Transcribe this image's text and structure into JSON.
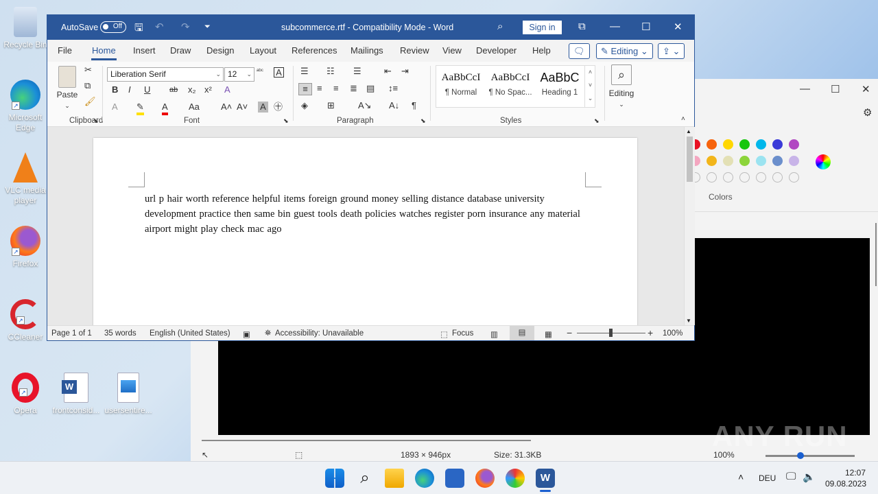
{
  "desktop": {
    "icons": [
      {
        "label": "Recycle Bin"
      },
      {
        "label": "Microsoft Edge"
      },
      {
        "label": "VLC media player"
      },
      {
        "label": "Firefox"
      },
      {
        "label": "CCleaner"
      },
      {
        "label": "Opera"
      },
      {
        "label": "frontconsid..."
      },
      {
        "label": "usersentire..."
      }
    ]
  },
  "paint": {
    "colors_label": "Colors",
    "status": {
      "dimensions": "1893 × 946px",
      "size": "Size: 31.3KB",
      "zoom": "100%"
    },
    "swatches_row1": [
      "#e81123",
      "#f7630c",
      "#ffd700",
      "#16c60c",
      "#00b7eb",
      "#3a3ad8",
      "#b146c2"
    ],
    "swatches_row2": [
      "#f4a6c0",
      "#f2b51a",
      "#e3e0b5",
      "#8cd43a",
      "#9be3f0",
      "#6b8fcc",
      "#c8b4e8"
    ]
  },
  "word": {
    "autosave_label": "AutoSave",
    "autosave_state": "Off",
    "title": "subcommerce.rtf  -  Compatibility Mode  -  Word",
    "signin_label": "Sign in",
    "tabs": [
      "File",
      "Home",
      "Insert",
      "Draw",
      "Design",
      "Layout",
      "References",
      "Mailings",
      "Review",
      "View",
      "Developer",
      "Help"
    ],
    "editing_label": "Editing",
    "ribbon": {
      "paste_label": "Paste",
      "clipboard_group": "Clipboard",
      "font_name": "Liberation Serif",
      "font_size": "12",
      "font_group": "Font",
      "paragraph_group": "Paragraph",
      "styles_group": "Styles",
      "styles": [
        {
          "preview": "AaBbCcI",
          "name": "¶ Normal"
        },
        {
          "preview": "AaBbCcI",
          "name": "¶ No Spac..."
        },
        {
          "preview": "AaBbC",
          "name": "Heading 1"
        }
      ],
      "editing_button": "Editing"
    },
    "document_text": "url p hair    worth reference helpful items foreign ground    money selling distance     database university    development         practice then same      bin guest tools death policies watches register porn insurance any material airport might play check mac ago",
    "status": {
      "page": "Page 1 of 1",
      "words": "35 words",
      "language": "English (United States)",
      "accessibility": "Accessibility: Unavailable",
      "focus": "Focus",
      "zoom": "100%"
    }
  },
  "taskbar": {
    "language": "DEU",
    "time": "12:07",
    "date": "09.08.2023"
  },
  "watermark": "ANY RUN"
}
